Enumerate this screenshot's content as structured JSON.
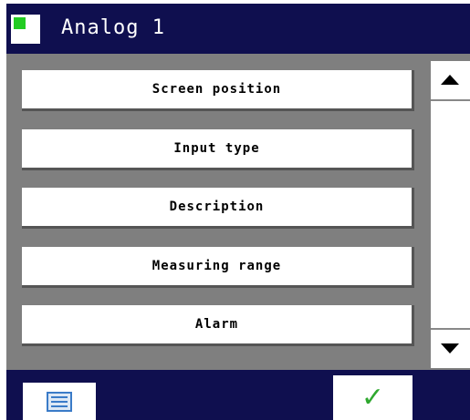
{
  "window": {
    "title": "Analog 1"
  },
  "menu": {
    "items": [
      {
        "label": "Screen position"
      },
      {
        "label": "Input type"
      },
      {
        "label": "Description"
      },
      {
        "label": "Measuring range"
      },
      {
        "label": "Alarm"
      }
    ]
  },
  "bottom": {
    "ok_symbol": "✓"
  },
  "colors": {
    "bar_background": "#0f0f4f",
    "panel_background": "#7f7f7f",
    "button_background": "#ffffff",
    "icon_accent": "#22cc22",
    "check_color": "#2fa82f"
  },
  "icons": {
    "app": "grid-window-icon",
    "scroll_up": "triangle-up-icon",
    "scroll_down": "triangle-down-icon",
    "menu": "list-window-icon",
    "ok": "checkmark-icon"
  }
}
